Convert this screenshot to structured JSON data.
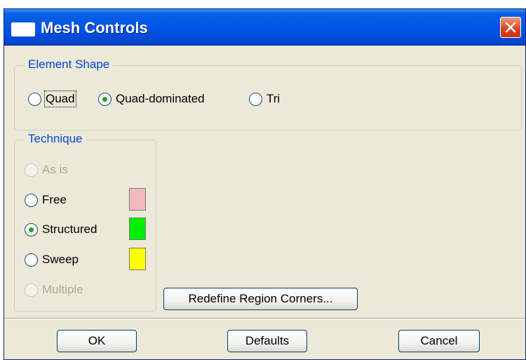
{
  "window": {
    "title": "Mesh Controls",
    "close_icon": "close-icon"
  },
  "element_shape": {
    "legend": "Element Shape",
    "options": [
      {
        "label": "Quad",
        "selected": false,
        "enabled": true
      },
      {
        "label": "Quad-dominated",
        "selected": true,
        "enabled": true
      },
      {
        "label": "Tri",
        "selected": false,
        "enabled": true
      }
    ]
  },
  "technique": {
    "legend": "Technique",
    "options": [
      {
        "label": "As is",
        "selected": false,
        "enabled": false
      },
      {
        "label": "Free",
        "selected": false,
        "enabled": true,
        "color": "#f4b8bf"
      },
      {
        "label": "Structured",
        "selected": true,
        "enabled": true,
        "color": "#00ee00"
      },
      {
        "label": "Sweep",
        "selected": false,
        "enabled": true,
        "color": "#ffff00"
      },
      {
        "label": "Multiple",
        "selected": false,
        "enabled": false
      }
    ]
  },
  "buttons": {
    "redefine": "Redefine Region Corners...",
    "ok": "OK",
    "defaults": "Defaults",
    "cancel": "Cancel"
  }
}
